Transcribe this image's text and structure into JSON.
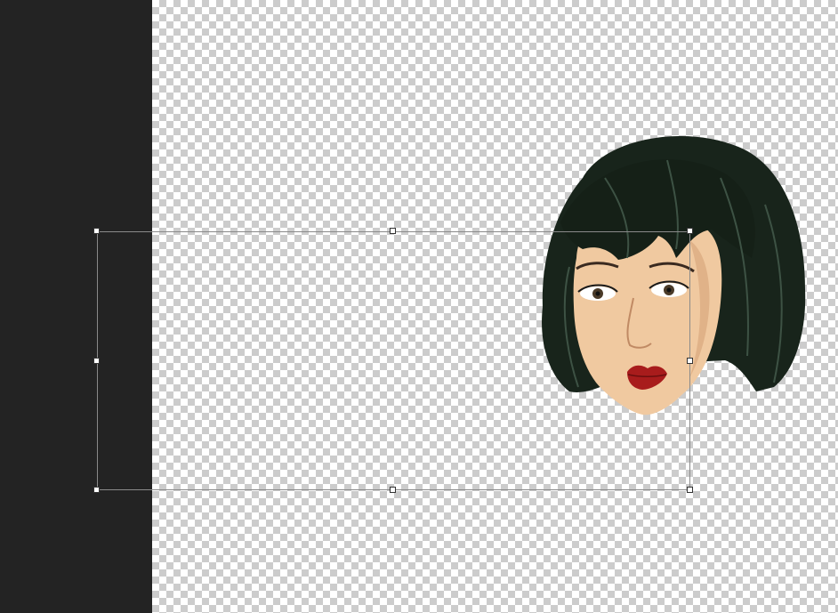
{
  "app": {
    "tool": "free-transform"
  },
  "canvas": {
    "background": "transparent-checkerboard",
    "checker_colors": [
      "#ffffff",
      "#cccccc"
    ]
  },
  "pasteboard": {
    "color": "#232323"
  },
  "layer": {
    "content": "portrait-illustration",
    "colors": {
      "hair": "#1c2a1f",
      "skin": "#f0c9a0",
      "lips": "#a81c1c"
    }
  },
  "transform_box": {
    "border_color": "#8a8a8a",
    "handles": [
      "top-left",
      "top-center",
      "top-right",
      "middle-left",
      "middle-right",
      "bottom-left",
      "bottom-center",
      "bottom-right"
    ]
  }
}
